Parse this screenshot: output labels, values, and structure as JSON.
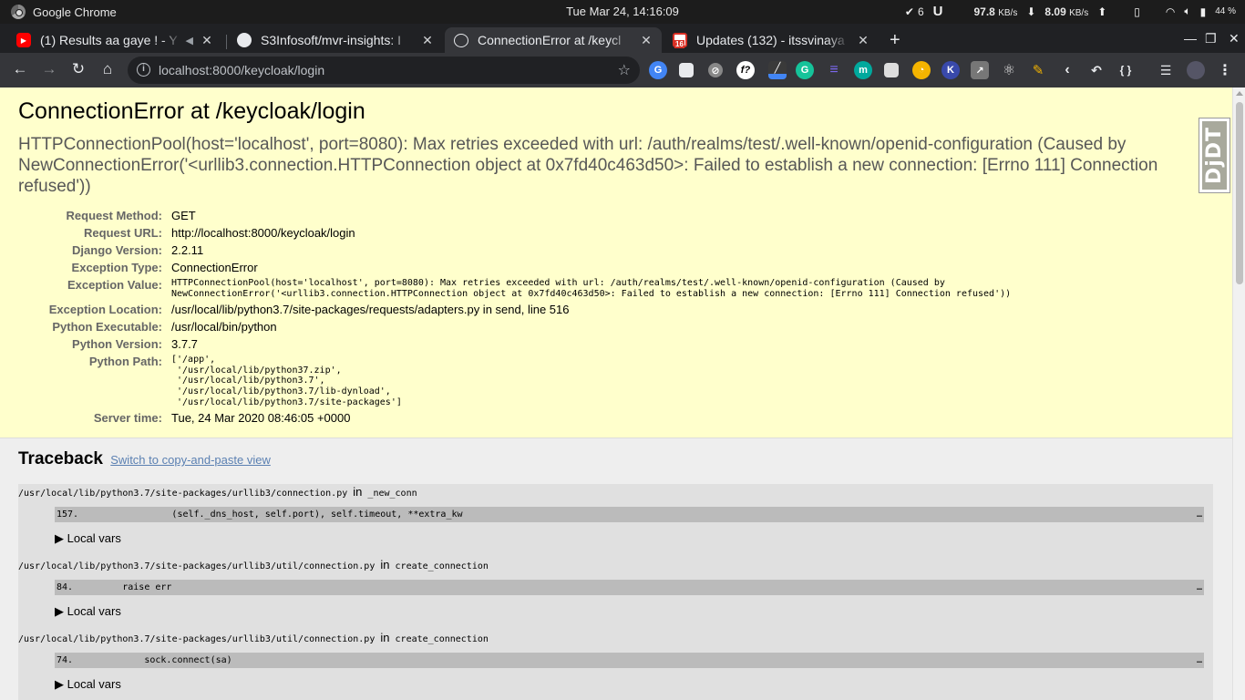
{
  "os": {
    "app_name": "Google Chrome",
    "clock": "Tue Mar 24, 14:16:09",
    "tray": {
      "check_count": "6",
      "down_speed": "97.8",
      "down_unit": "KB/s",
      "up_speed": "8.09",
      "up_unit": "KB/s",
      "battery": "44",
      "battery_unit": "%"
    }
  },
  "tabs": [
    {
      "title": "(1) Results aa gaye ! - Y",
      "favicon": "youtube-icon",
      "color": "#ff0000"
    },
    {
      "title": "S3Infosoft/mvr-insights: I",
      "favicon": "github-icon",
      "color": "#e8eaed"
    },
    {
      "title": "ConnectionError at /keycl",
      "favicon": "globe-icon",
      "color": "#e8eaed",
      "active": true
    },
    {
      "title": "Updates (132) - itssvinaya",
      "favicon": "gmail-icon",
      "color": "#d93025",
      "badge": "16"
    }
  ],
  "toolbar": {
    "url": "localhost:8000/keycloak/login"
  },
  "page": {
    "title": "ConnectionError at /keycloak/login",
    "exception_value": "HTTPConnectionPool(host='localhost', port=8080): Max retries exceeded with url: /auth/realms/test/.well-known/openid-configuration (Caused by NewConnectionError('<urllib3.connection.HTTPConnection object at 0x7fd40c463d50>: Failed to establish a new connection: [Errno 111] Connection refused'))",
    "meta": {
      "request_method_label": "Request Method:",
      "request_method": "GET",
      "request_url_label": "Request URL:",
      "request_url": "http://localhost:8000/keycloak/login",
      "django_version_label": "Django Version:",
      "django_version": "2.2.11",
      "exception_type_label": "Exception Type:",
      "exception_type": "ConnectionError",
      "exception_value_label": "Exception Value:",
      "exception_value": "HTTPConnectionPool(host='localhost', port=8080): Max retries exceeded with url: /auth/realms/test/.well-known/openid-configuration (Caused by\nNewConnectionError('<urllib3.connection.HTTPConnection object at 0x7fd40c463d50>: Failed to establish a new connection: [Errno 111] Connection refused'))",
      "exception_location_label": "Exception Location:",
      "exception_location": "/usr/local/lib/python3.7/site-packages/requests/adapters.py in send, line 516",
      "python_executable_label": "Python Executable:",
      "python_executable": "/usr/local/bin/python",
      "python_version_label": "Python Version:",
      "python_version": "3.7.7",
      "python_path_label": "Python Path:",
      "python_path": "['/app',\n '/usr/local/lib/python37.zip',\n '/usr/local/lib/python3.7',\n '/usr/local/lib/python3.7/lib-dynload',\n '/usr/local/lib/python3.7/site-packages']",
      "server_time_label": "Server time:",
      "server_time": "Tue, 24 Mar 2020 08:46:05 +0000"
    },
    "djdt_label": "DjDT",
    "traceback": {
      "heading": "Traceback",
      "switch_link": "Switch to copy-and-paste view",
      "in_word": "in",
      "ellipsis": "…",
      "local_vars_label": "▶ Local vars",
      "frames": [
        {
          "file": "/usr/local/lib/python3.7/site-packages/urllib3/connection.py",
          "func": "_new_conn",
          "code": "157.                 (self._dns_host, self.port), self.timeout, **extra_kw"
        },
        {
          "file": "/usr/local/lib/python3.7/site-packages/urllib3/util/connection.py",
          "func": "create_connection",
          "code": "84.         raise err"
        },
        {
          "file": "/usr/local/lib/python3.7/site-packages/urllib3/util/connection.py",
          "func": "create_connection",
          "code": "74.             sock.connect(sa)"
        }
      ]
    }
  }
}
